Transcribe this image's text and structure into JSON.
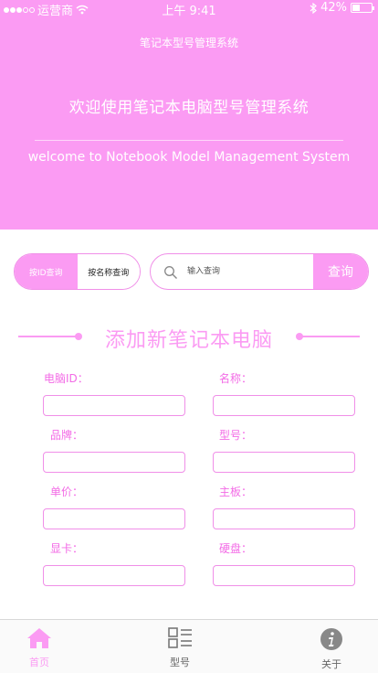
{
  "status_bar": {
    "carrier": "运营商",
    "time": "上午 9:41",
    "battery_text": "42%",
    "battery_level": 0.42
  },
  "nav": {
    "title": "笔记本型号管理系统"
  },
  "hero": {
    "welcome_cn": "欢迎使用笔记本电脑型号管理系统",
    "welcome_en": "welcome to Notebook Model Management System"
  },
  "search": {
    "mode_by_id": "按ID查询",
    "mode_by_name": "按名称查询",
    "placeholder": "输入查询",
    "button": "查询"
  },
  "form": {
    "title": "添加新笔记本电脑",
    "fields": {
      "id": "电脑ID：",
      "name": "名称：",
      "brand": "品牌：",
      "model": "型号：",
      "price": "单价：",
      "motherboard": "主板：",
      "gpu": "显卡：",
      "disk": "硬盘："
    }
  },
  "tabbar": {
    "home": "首页",
    "models": "型号",
    "about": "关于"
  },
  "colors": {
    "accent": "#fb9bf3",
    "label": "#f36be6",
    "tab_inactive": "#666666"
  }
}
